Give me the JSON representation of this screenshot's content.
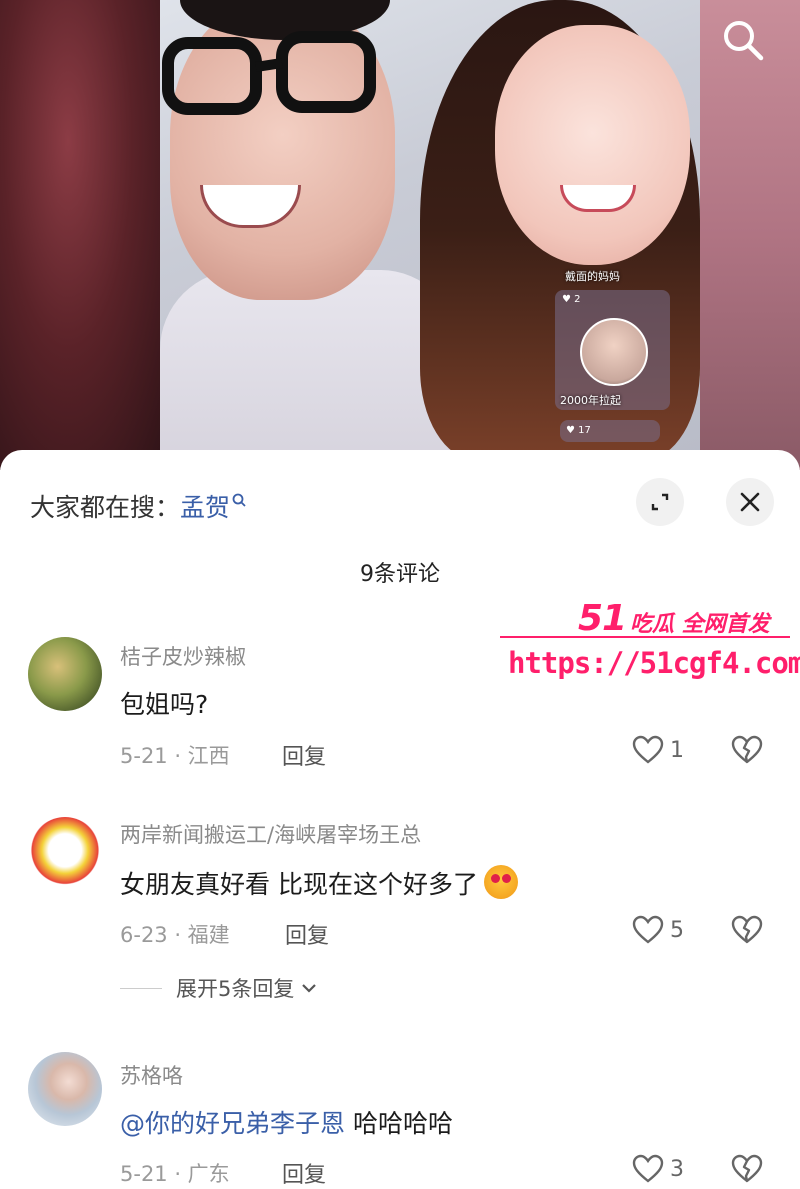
{
  "video": {
    "rank_label": "戴面的妈妈",
    "rank_badge_1": "2",
    "rank_year": "2000年拉起",
    "rank_badge_2": "17"
  },
  "header": {
    "trending_prefix": "大家都在搜：",
    "trending_keyword": "孟贺"
  },
  "comment_count": "9条评论",
  "watermark": {
    "brand_num": "51",
    "brand_text": "吃瓜 全网首发",
    "url": "https://51cgf4.com"
  },
  "comments": [
    {
      "username": "桔子皮炒辣椒",
      "text": "包姐吗?",
      "date_location": "5-21 · 江西",
      "reply_label": "回复",
      "likes": "1"
    },
    {
      "username": "两岸新闻搬运工/海峡屠宰场王总",
      "text": "女朋友真好看 比现在这个好多了",
      "emoji": "heart-eyes-emoji",
      "date_location": "6-23 · 福建",
      "reply_label": "回复",
      "likes": "5",
      "expand_replies": "展开5条回复"
    },
    {
      "username": "苏格咯",
      "text": "@你的好兄弟李子恩  哈哈哈哈",
      "date_location": "5-21 · 广东",
      "reply_label": "回复",
      "likes": "3"
    }
  ]
}
